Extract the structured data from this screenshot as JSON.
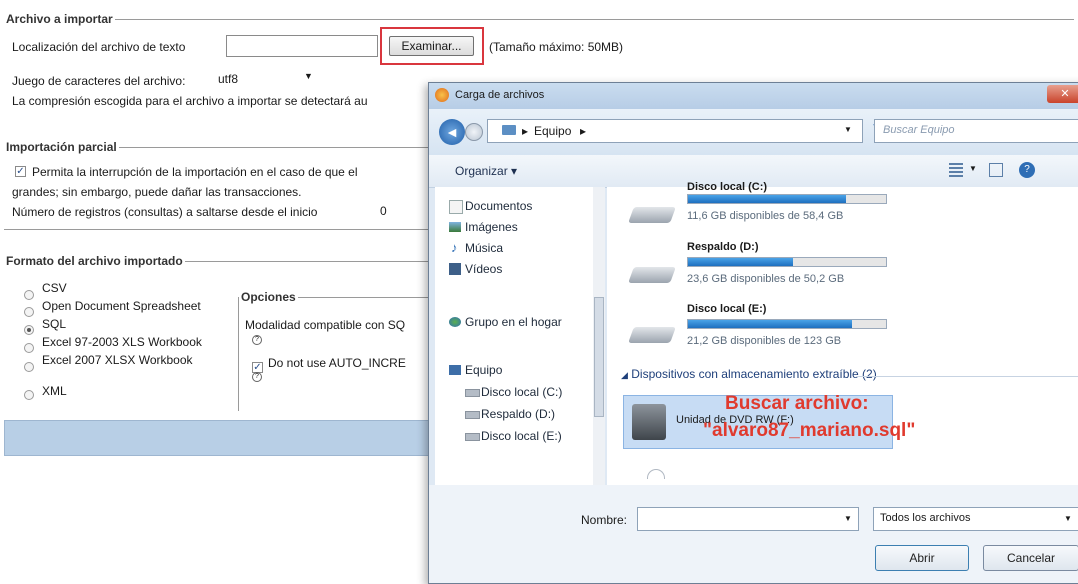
{
  "archivo": {
    "legend": "Archivo a importar",
    "location_label": "Localización del archivo de texto",
    "browse_button": "Examinar...",
    "max_size": "(Tamaño máximo: 50MB)",
    "charset_label": "Juego de caracteres del archivo:",
    "charset_value": "utf8",
    "compression_note": "La compresión escogida para el archivo a importar se detectará au"
  },
  "parcial": {
    "legend": "Importación parcial",
    "allow_interrupt_line1": "Permita la interrupción de la importación en el caso de que el",
    "allow_interrupt_line2": "grandes; sin embargo, puede dañar las transacciones.",
    "skip_label": "Número de registros (consultas) a saltarse desde el inicio",
    "skip_value": "0"
  },
  "formato": {
    "legend": "Formato del archivo importado",
    "options": [
      "CSV",
      "Open Document Spreadsheet",
      "SQL",
      "Excel 97-2003 XLS Workbook",
      "Excel 2007 XLSX Workbook",
      "XML"
    ],
    "selected": "SQL",
    "opciones_legend": "Opciones",
    "compat_label": "Modalidad compatible con SQ",
    "no_auto_inc": "Do not use AUTO_INCRE"
  },
  "dialog": {
    "title": "Carga de archivos",
    "breadcrumb": "Equipo",
    "search_placeholder": "Buscar Equipo",
    "organize": "Organizar",
    "nav_items": [
      "Documentos",
      "Imágenes",
      "Música",
      "Vídeos",
      "Grupo en el hogar",
      "Equipo",
      "Disco local (C:)",
      "Respaldo (D:)",
      "Disco local (E:)"
    ],
    "drives": [
      {
        "name": "Disco local (C:)",
        "free": "11,6 GB disponibles de 58,4 GB",
        "used_fraction": 0.8
      },
      {
        "name": "Respaldo (D:)",
        "free": "23,6 GB disponibles de 50,2 GB",
        "used_fraction": 0.53
      },
      {
        "name": "Disco local (E:)",
        "free": "21,2 GB disponibles de 123 GB",
        "used_fraction": 0.83
      }
    ],
    "removable_header": "Dispositivos con almacenamiento extraíble (2)",
    "dvd_name": "Unidad de DVD RW (F:)",
    "annotation_line1": "Buscar archivo:",
    "annotation_line2": "\"alvaro87_mariano.sql\"",
    "filename_label": "Nombre:",
    "filename_value": "",
    "filetype": "Todos los archivos",
    "open_button": "Abrir",
    "cancel_button": "Cancelar"
  },
  "colors": {
    "highlight_red": "#d9363e",
    "annotation_red": "#e03a2e",
    "selection": "#c7dcf4",
    "blue_footer": "#b8cfe6"
  }
}
